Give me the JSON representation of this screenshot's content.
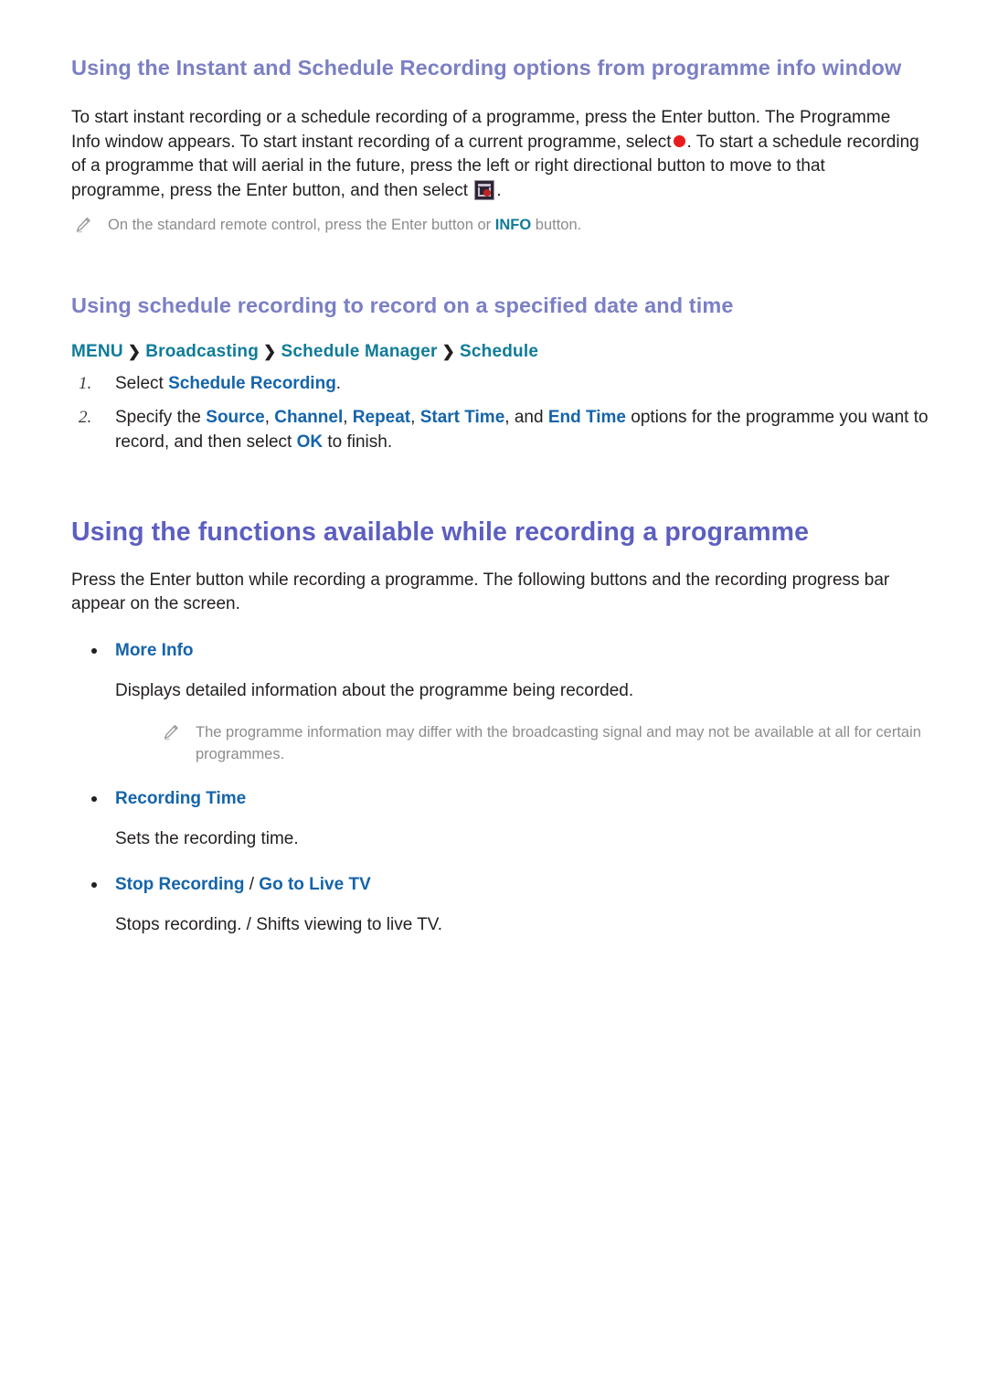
{
  "section1": {
    "heading": "Using the Instant and Schedule Recording options from programme info window",
    "para_part1": "To start instant recording or a schedule recording of a programme, press the Enter button. The Programme Info window appears. To start instant recording of a current programme, select",
    "para_part2": ". To start a schedule recording of a programme that will aerial in the future, press the left or right directional button to move to that programme, press the Enter button, and then select",
    "para_part3": ".",
    "record_icon_name": "record-dot-icon",
    "schedule_icon_name": "schedule-recording-icon",
    "note": {
      "icon": "pencil-icon",
      "text_before": "On the standard remote control, press the Enter button or",
      "link": "INFO",
      "text_after": "button."
    }
  },
  "section2": {
    "heading": "Using schedule recording to record on a specified date and time",
    "breadcrumb": {
      "items": [
        "MENU",
        "Broadcasting",
        "Schedule Manager",
        "Schedule"
      ],
      "separator": "❯"
    },
    "steps": [
      {
        "num": "1.",
        "text_before": "Select",
        "link": "Schedule Recording",
        "text_after": "."
      },
      {
        "num": "2.",
        "text_before": "Specify the",
        "links": [
          "Source",
          "Channel",
          "Repeat",
          "Start Time"
        ],
        "text_mid": ", and",
        "link_last": "End Time",
        "text_after": "options for the programme you want to record, and then select",
        "link_ok": "OK",
        "text_end": "to finish."
      }
    ]
  },
  "section3": {
    "heading": "Using the functions available while recording a programme",
    "intro": "Press the Enter button while recording a programme. The following buttons and the recording progress bar appear on the screen.",
    "bullets": [
      {
        "title": "More Info",
        "desc": "Displays detailed information about the programme being recorded.",
        "note": {
          "icon": "pencil-icon",
          "text": "The programme information may differ with the broadcasting signal and may not be available at all for certain programmes."
        }
      },
      {
        "title": "Recording Time",
        "desc": "Sets the recording time."
      },
      {
        "title_a": "Stop Recording",
        "title_sep": " / ",
        "title_b": "Go to Live TV",
        "desc": "Stops recording. / Shifts viewing to live TV."
      }
    ]
  },
  "colors": {
    "h1": "#5c5fc0",
    "h2": "#7b7fc4",
    "link_blue": "#1464aa",
    "teal": "#0f7b99",
    "body": "#231f20",
    "note_gray": "#8c8c8c",
    "record_red": "#e81c1c"
  }
}
